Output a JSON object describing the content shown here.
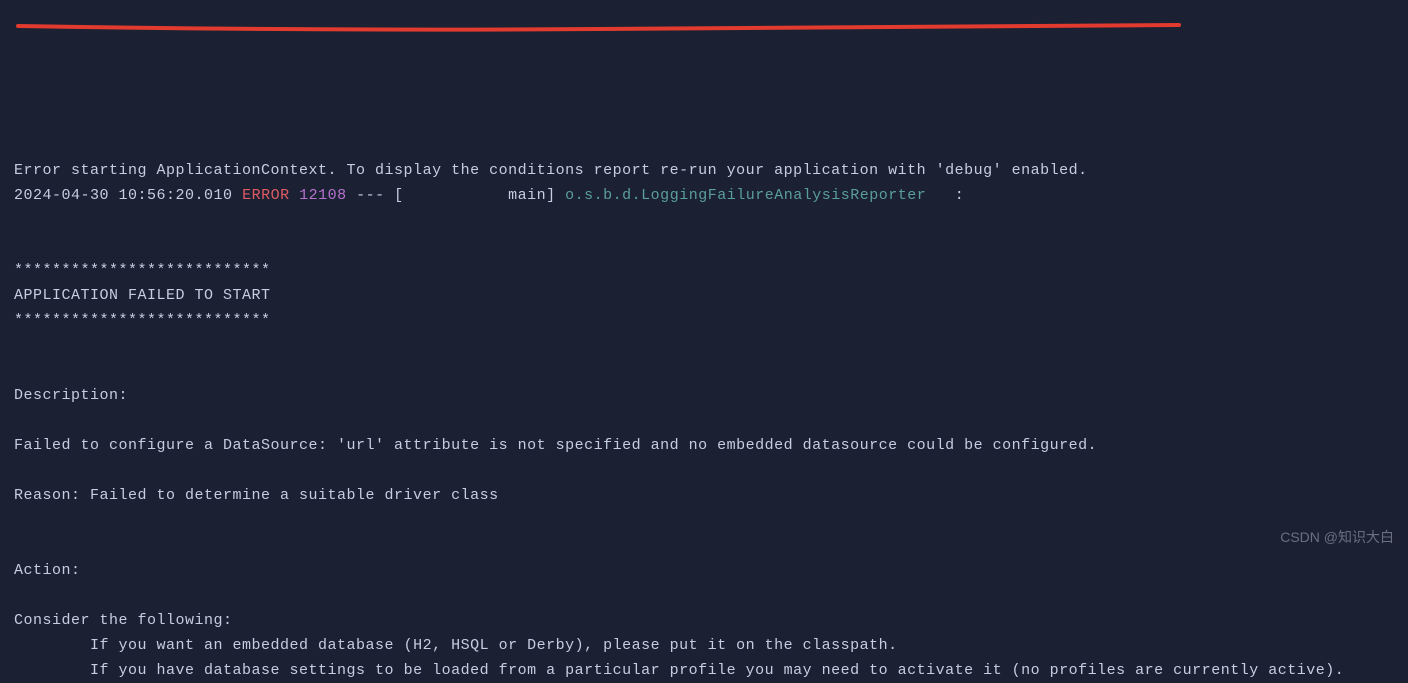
{
  "log": {
    "line1": "Error starting ApplicationContext. To display the conditions report re-run your application with 'debug' enabled.",
    "timestamp": "2024-04-30 10:56:20.010",
    "level": "ERROR",
    "pid": "12108",
    "separator": "--- [           main]",
    "logger": "o.s.b.d.LoggingFailureAnalysisReporter",
    "colon": "   :",
    "stars": "***************************",
    "banner": "APPLICATION FAILED TO START",
    "descriptionLabel": "Description:",
    "descriptionText": "Failed to configure a DataSource: 'url' attribute is not specified and no embedded datasource could be configured.",
    "reason": "Reason: Failed to determine a suitable driver class",
    "actionLabel": "Action:",
    "considerLabel": "Consider the following:",
    "considerBullet1": "\tIf you want an embedded database (H2, HSQL or Derby), please put it on the classpath.",
    "considerBullet2": "\tIf you have database settings to be loaded from a particular profile you may need to activate it (no profiles are currently active)."
  },
  "watermark": "CSDN @知识大白"
}
